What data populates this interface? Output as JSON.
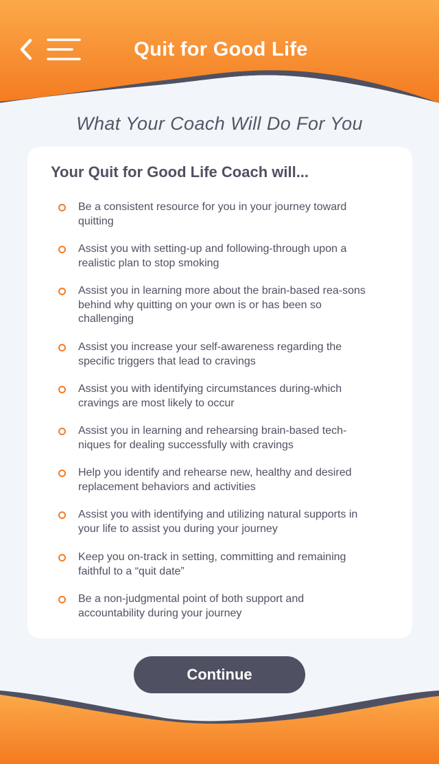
{
  "header": {
    "title": "Quit for Good Life",
    "back_icon": "chevron-left-icon",
    "menu_icon": "hamburger-menu-icon"
  },
  "subtitle": "What Your Coach Will Do For You",
  "card": {
    "heading": "Your Quit for Good Life Coach will...",
    "items": [
      {
        "text": "Be a consistent resource for you in your journey toward quitting"
      },
      {
        "text": "Assist you with setting-up and following-through upon a realistic plan to stop smoking"
      },
      {
        "text": "Assist you in learning more about the brain-based rea-sons behind why quitting on your own is or has been so challenging"
      },
      {
        "text": "Assist you increase your self-awareness regarding the specific triggers that lead to cravings"
      },
      {
        "text": "Assist you with identifying circumstances during-which cravings are most likely to occur"
      },
      {
        "text": "Assist you in learning and rehearsing brain-based tech-niques for dealing successfully with cravings"
      },
      {
        "text": "Help you identify and rehearse new, healthy and desired replacement behaviors and activities"
      },
      {
        "text": "Assist you with identifying and utilizing natural supports in your life to assist you during your journey"
      },
      {
        "text": "Keep you on-track in setting, committing and remaining faithful to a “quit date”"
      },
      {
        "text": "Be a non-judgmental point of both support and accountability during your journey"
      }
    ]
  },
  "continue_label": "Continue",
  "colors": {
    "accent_orange": "#f47b20",
    "orange_light": "#fba94a",
    "dark_slate": "#4f5162",
    "background": "#f2f5f9"
  }
}
